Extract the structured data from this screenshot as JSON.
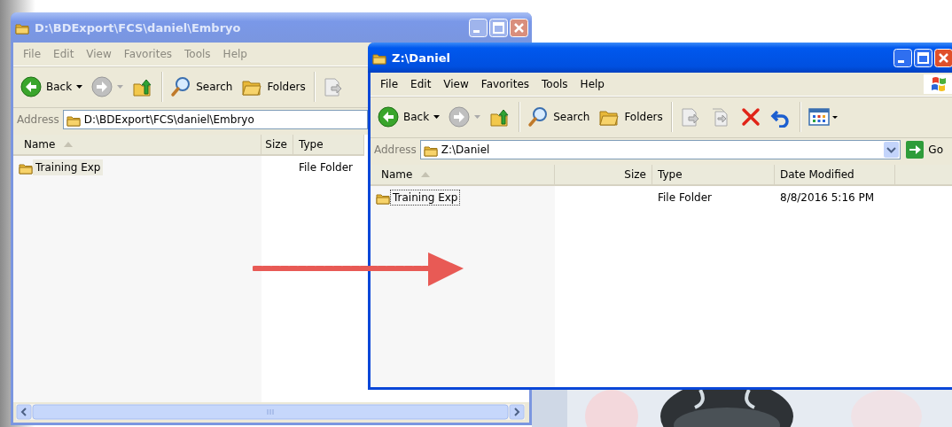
{
  "windows": [
    {
      "title": "D:\\BDExport\\FCS\\daniel\\Embryo",
      "active": false,
      "menu": [
        "File",
        "Edit",
        "View",
        "Favorites",
        "Tools",
        "Help"
      ],
      "toolbar": [
        {
          "kind": "back",
          "label": "Back"
        },
        {
          "kind": "forward"
        },
        {
          "kind": "up"
        },
        {
          "kind": "separator"
        },
        {
          "kind": "search",
          "label": "Search"
        },
        {
          "kind": "folders",
          "label": "Folders"
        },
        {
          "kind": "separator"
        },
        {
          "kind": "move"
        }
      ],
      "address": {
        "label": "Address",
        "value": "D:\\BDExport\\FCS\\daniel\\Embryo"
      },
      "columns": [
        {
          "kind": "name",
          "label": "Name",
          "sorted": true
        },
        {
          "kind": "size",
          "label": "Size",
          "sorted": false
        },
        {
          "kind": "type",
          "label": "Type",
          "sorted": false
        }
      ],
      "rows": [
        {
          "name": "Training Exp",
          "type": "File Folder",
          "selected": true,
          "focused": false
        }
      ],
      "horizontal_scrollbar": true
    },
    {
      "title": "Z:\\Daniel",
      "active": true,
      "brand_logo": true,
      "menu": [
        "File",
        "Edit",
        "View",
        "Favorites",
        "Tools",
        "Help"
      ],
      "toolbar": [
        {
          "kind": "back",
          "label": "Back"
        },
        {
          "kind": "forward"
        },
        {
          "kind": "up"
        },
        {
          "kind": "separator"
        },
        {
          "kind": "search",
          "label": "Search"
        },
        {
          "kind": "folders",
          "label": "Folders"
        },
        {
          "kind": "separator"
        },
        {
          "kind": "move"
        },
        {
          "kind": "copy"
        },
        {
          "kind": "delete"
        },
        {
          "kind": "undo"
        },
        {
          "kind": "separator"
        },
        {
          "kind": "views"
        }
      ],
      "address": {
        "label": "Address",
        "value": "Z:\\Daniel",
        "dropdown": true,
        "go": "Go"
      },
      "columns": [
        {
          "kind": "name",
          "label": "Name",
          "sorted": true
        },
        {
          "kind": "size",
          "label": "Size",
          "sorted": false
        },
        {
          "kind": "type",
          "label": "Type",
          "sorted": false
        },
        {
          "kind": "date",
          "label": "Date Modified",
          "sorted": false
        },
        {
          "kind": "blank"
        }
      ],
      "rows": [
        {
          "name": "Training Exp",
          "type": "File Folder",
          "date": "8/8/2016 5:16 PM",
          "selected": false,
          "focused": true
        }
      ]
    }
  ],
  "annotation": {
    "kind": "arrow"
  }
}
